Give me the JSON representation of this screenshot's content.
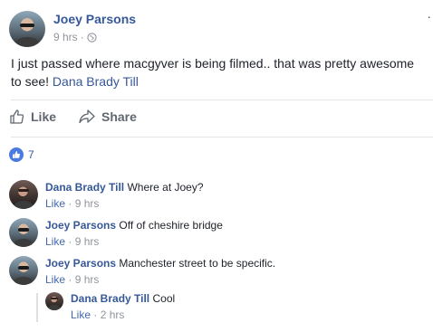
{
  "post": {
    "author": "Joey Parsons",
    "time": "9 hrs",
    "separator": "·",
    "audience_icon": "globe-icon",
    "text": "I just passed where macgyver is being filmed.. that was pretty awesome to see! ",
    "mention": "Dana Brady Till"
  },
  "actions": {
    "like_label": "Like",
    "share_label": "Share"
  },
  "reactions": {
    "icon": "like-icon",
    "count": "7"
  },
  "comments": [
    {
      "author": "Dana Brady Till",
      "text": "Where at Joey?",
      "like": "Like",
      "sep": " · ",
      "time": "9 hrs"
    },
    {
      "author": "Joey Parsons",
      "text": "Off of cheshire bridge",
      "like": "Like",
      "sep": " · ",
      "time": "9 hrs"
    },
    {
      "author": "Joey Parsons",
      "text": "Manchester street to be specific.",
      "like": "Like",
      "sep": " · ",
      "time": "9 hrs"
    }
  ],
  "replies": [
    {
      "author": "Dana Brady Till",
      "text": "Cool",
      "like": "Like",
      "sep": " · ",
      "time": "2 hrs"
    }
  ],
  "colors": {
    "link": "#365899",
    "meta": "#90949c",
    "text": "#1d2129",
    "like_badge": "#4a7be0"
  }
}
